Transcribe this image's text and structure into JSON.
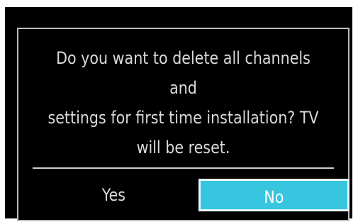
{
  "dialog": {
    "message_lines": [
      "Do you want to delete all channels and",
      "settings for first time installation? TV",
      "will be reset."
    ],
    "buttons": {
      "yes": "Yes",
      "no": "No"
    },
    "selected_button": "No",
    "colors": {
      "background": "#000000",
      "text": "#d9d9d9",
      "selected_bg": "#37c5df",
      "border": "#bdbdbd"
    }
  }
}
